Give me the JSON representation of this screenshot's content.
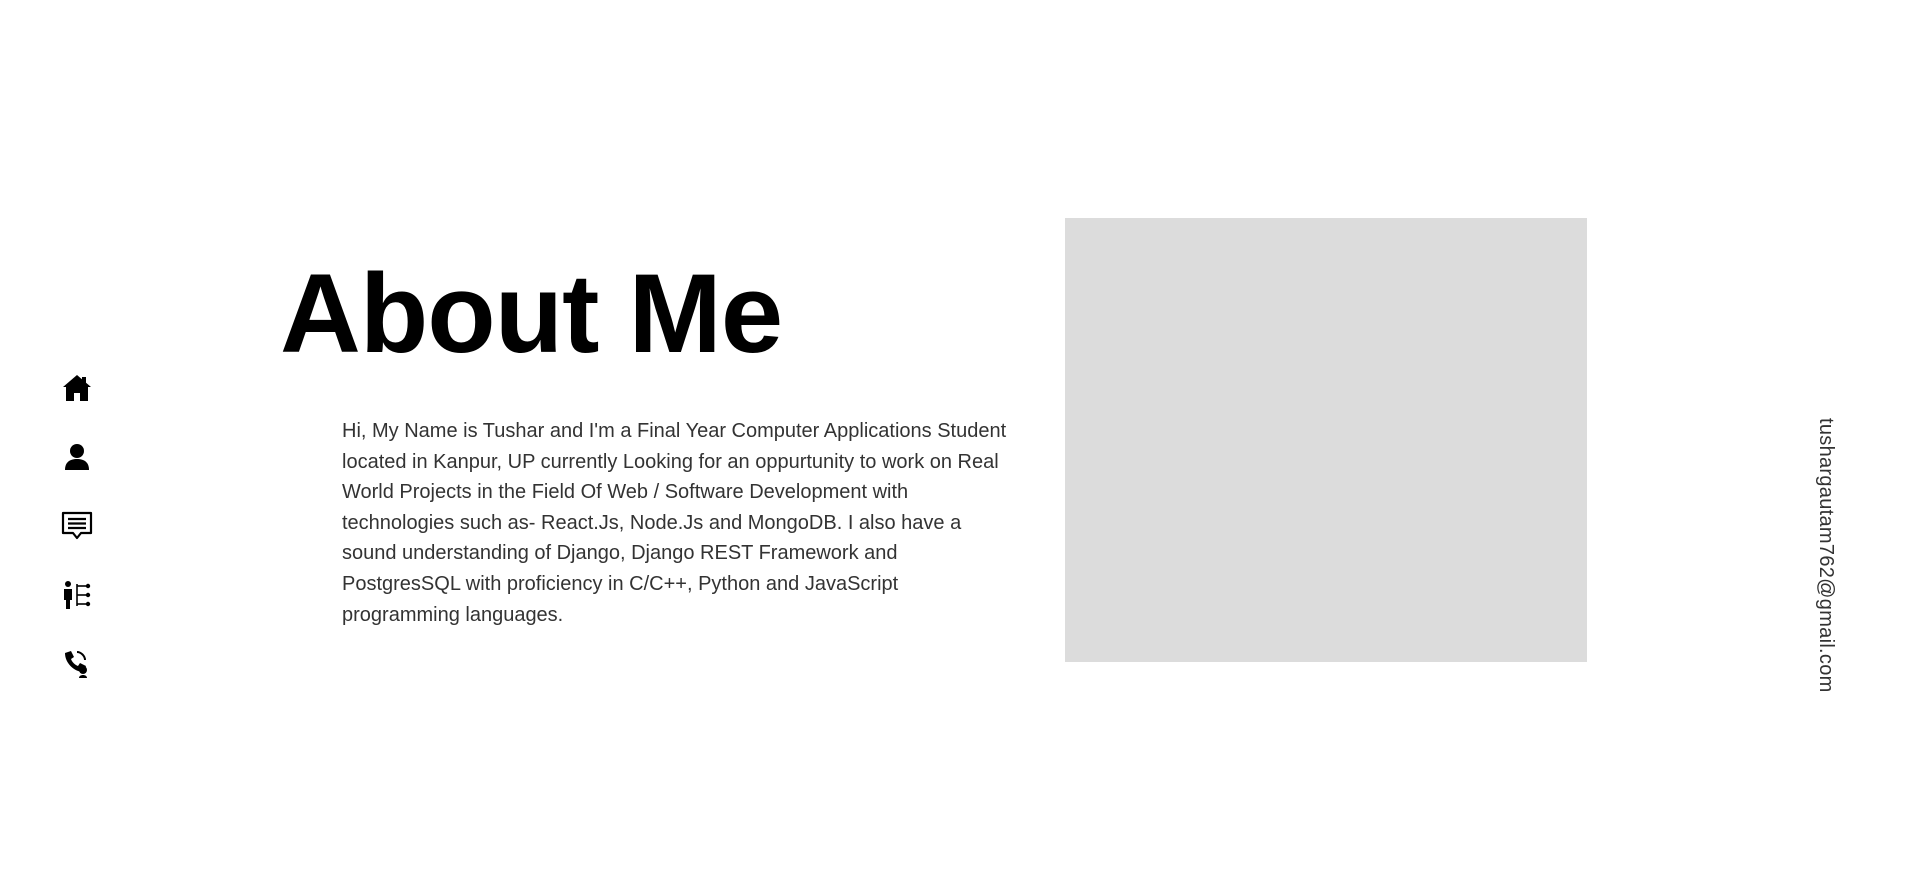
{
  "sidebar": {
    "items": [
      {
        "icon": "home-icon"
      },
      {
        "icon": "user-icon"
      },
      {
        "icon": "message-icon"
      },
      {
        "icon": "skills-icon"
      },
      {
        "icon": "contact-icon"
      }
    ]
  },
  "about": {
    "title": "About Me",
    "bio": "Hi, My Name is Tushar and I'm a Final Year Computer Applications Student located in Kanpur, UP currently Looking for an oppurtunity to work on Real World Projects in the Field Of Web / Software Development with technologies such as- React.Js, Node.Js and MongoDB. I also have a sound understanding of Django, Django REST Framework and PostgresSQL with proficiency in C/C++, Python and JavaScript programming languages."
  },
  "contact": {
    "email": "tushargautam762@gmail.com"
  },
  "colors": {
    "text": "#333333",
    "heading": "#000000",
    "placeholder": "#dcdcdc",
    "background": "#ffffff"
  }
}
